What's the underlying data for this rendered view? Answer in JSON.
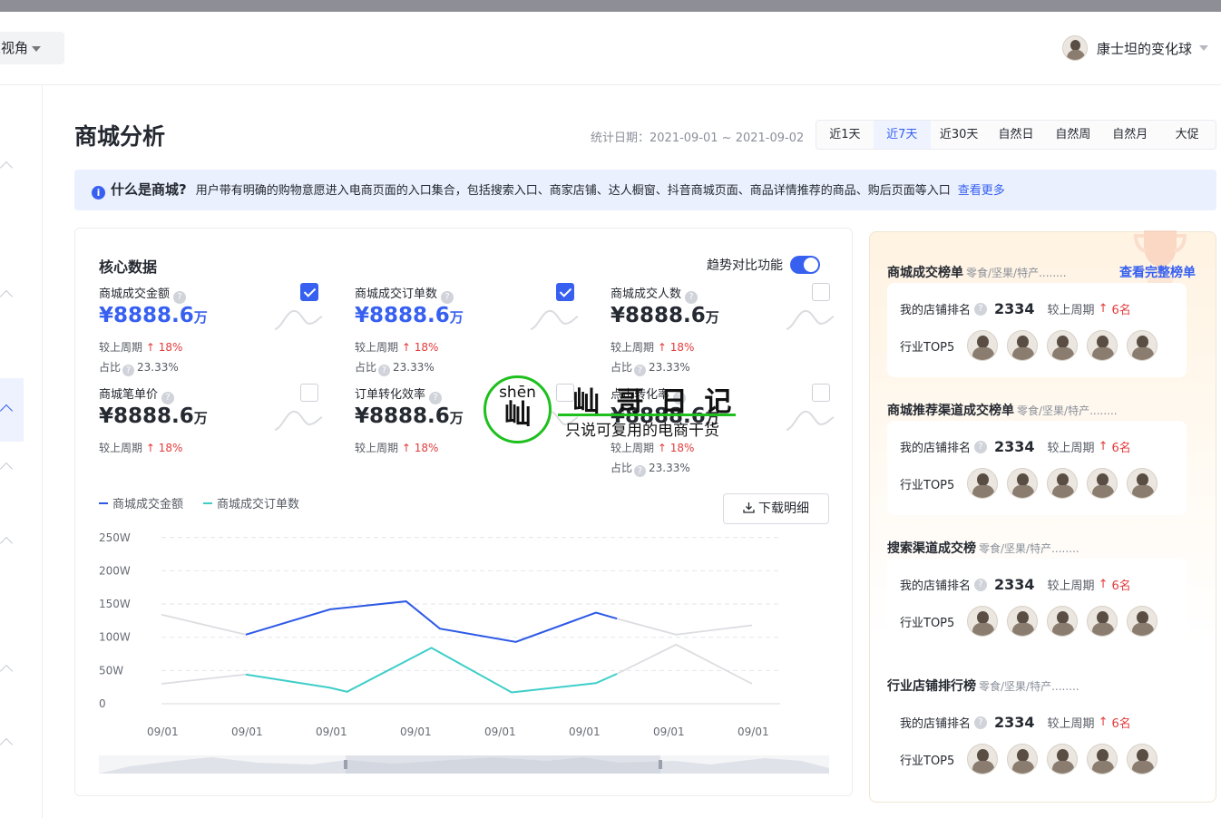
{
  "header": {
    "view_label": "家视角",
    "username": "康士坦的变化球"
  },
  "page": {
    "title": "商城分析",
    "date_label": "统计日期：2021-09-01 ~ 2021-09-02"
  },
  "tabs": [
    {
      "label": "近1天",
      "active": false
    },
    {
      "label": "近7天",
      "active": true
    },
    {
      "label": "近30天",
      "active": false
    },
    {
      "label": "自然日",
      "active": false
    },
    {
      "label": "自然周",
      "active": false
    },
    {
      "label": "自然月",
      "active": false
    },
    {
      "label": "大促",
      "active": false
    }
  ],
  "notice": {
    "question": "什么是商城?",
    "text": "用户带有明确的购物意愿进入电商页面的入口集合，包括搜索入口、商家店铺、达人橱窗、抖音商城页面、商品详情推荐的商品、购后页面等入口",
    "link": "查看更多"
  },
  "core": {
    "title": "核心数据",
    "trend_label": "趋势对比功能",
    "cmp_label": "较上周期",
    "share_label": "占比",
    "metrics": [
      {
        "label": "商城成交金额",
        "value": "¥8888.6",
        "unit": "万",
        "cmp": "18%",
        "share": "23.33%",
        "checked": true
      },
      {
        "label": "商城成交订单数",
        "value": "¥8888.6",
        "unit": "万",
        "cmp": "18%",
        "share": "23.33%",
        "checked": true
      },
      {
        "label": "商城成交人数",
        "value": "¥8888.6",
        "unit": "万",
        "cmp": "18%",
        "share": "23.33%",
        "checked": false
      },
      {
        "label": "商城笔单价",
        "value": "¥8888.6",
        "unit": "万",
        "cmp": "18%",
        "checked": false
      },
      {
        "label": "订单转化效率",
        "value": "¥8888.6",
        "unit": "万",
        "cmp": "18%",
        "checked": false
      },
      {
        "label": "点击转化率",
        "value": "¥8888.6",
        "unit": "万",
        "cmp": "18%",
        "share": "23.33%",
        "checked": false
      }
    ],
    "download_label": "下载明细"
  },
  "chart_data": {
    "type": "line",
    "categories": [
      "09/01",
      "09/01",
      "09/01",
      "09/01",
      "09/01",
      "09/01",
      "09/01",
      "09/01"
    ],
    "y_ticks": [
      "0",
      "50W",
      "100W",
      "150W",
      "200W",
      "250W"
    ],
    "ylim": [
      0,
      250
    ],
    "series": [
      {
        "name": "商城成交金额",
        "color": "#2d59e6",
        "values": [
          134,
          104,
          142,
          154,
          113,
          93,
          137,
          128,
          104,
          118
        ],
        "x": [
          0,
          1,
          2,
          2.9,
          3.3,
          4.2,
          5.15,
          5.4,
          6.1,
          7
        ]
      },
      {
        "name": "商城成交订单数",
        "color": "#3ecec8",
        "values": [
          30,
          44,
          24,
          18,
          84,
          17,
          31,
          45,
          89,
          30
        ],
        "x": [
          0,
          1,
          2,
          2.2,
          3.2,
          4.15,
          5.15,
          5.4,
          6.1,
          7
        ]
      }
    ],
    "highlight_range": [
      2,
      5.4
    ],
    "compare_color": "#dcdde1"
  },
  "rankings": {
    "my_rank_label": "我的店铺排名",
    "top5_label": "行业TOP5",
    "cmp_label": "较上周期",
    "view_all": "查看完整榜单",
    "sections": [
      {
        "title": "商城成交榜单",
        "category": "零食/坚果/特产........",
        "rank": "2334",
        "change": "6名"
      },
      {
        "title": "商城推荐渠道成交榜单",
        "category": "零食/坚果/特产........",
        "rank": "2334",
        "change": "6名"
      },
      {
        "title": "搜索渠道成交榜",
        "category": "零食/坚果/特产........",
        "rank": "2334",
        "change": "6名"
      },
      {
        "title": "行业店铺排行榜",
        "category": "零食/坚果/特产........",
        "rank": "2334",
        "change": "6名"
      }
    ]
  },
  "watermark": {
    "pinyin": "shēn",
    "char": "屾",
    "title": "屾 哥 日 记",
    "subtitle": "只说可复用的电商干货"
  }
}
